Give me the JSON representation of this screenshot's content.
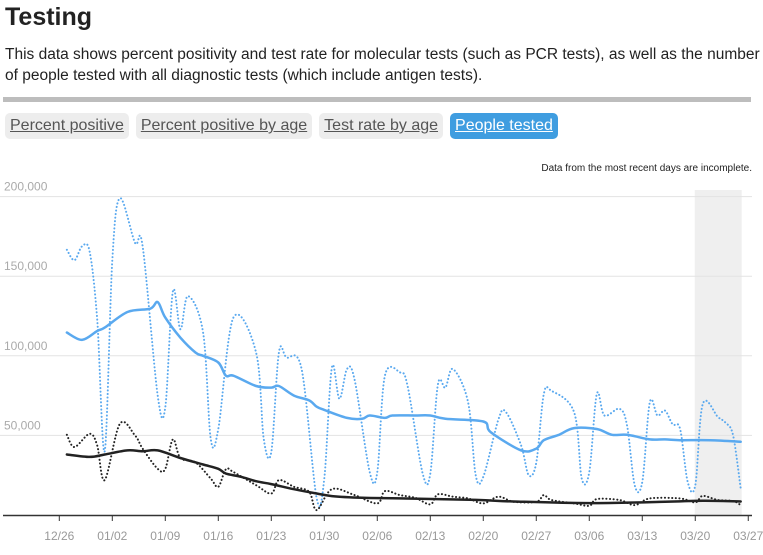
{
  "header": {
    "title": "Testing",
    "description": "This data shows percent positivity and test rate for molecular tests (such as PCR tests), as well as the number of people tested with all diagnostic tests (which include antigen tests)."
  },
  "tabs": [
    {
      "label": "Percent positive",
      "active": false
    },
    {
      "label": "Percent positive by age",
      "active": false
    },
    {
      "label": "Test rate by age",
      "active": false
    },
    {
      "label": "People tested",
      "active": true
    }
  ],
  "chart_note": "Data from the most recent days are incomplete.",
  "colors": {
    "blue": "#5aa9ef",
    "black": "#222222",
    "tab_active": "#3f9de0",
    "incomplete_shade": "#efefef",
    "grid": "#e3e3e3"
  },
  "chart_data": {
    "type": "line",
    "ylim": [
      0,
      200000
    ],
    "yticks": [
      "200,000",
      "150,000",
      "100,000",
      "50,000"
    ],
    "ytick_values": [
      200000,
      150000,
      100000,
      50000
    ],
    "xticks": [
      "12/26",
      "01/02",
      "01/09",
      "01/16",
      "01/23",
      "01/30",
      "02/06",
      "02/13",
      "02/20",
      "02/27",
      "03/06",
      "03/13",
      "03/20",
      "03/27"
    ],
    "xlim": [
      "12/26",
      "03/27"
    ],
    "grid": true,
    "incomplete_range": [
      "03/20",
      "03/26"
    ],
    "series": [
      {
        "color": "#5aa9ef",
        "style": "dotted",
        "points": [
          [
            "12/27",
            166600
          ],
          [
            "12/28",
            160000
          ],
          [
            "12/29",
            168700
          ],
          [
            "12/30",
            165600
          ],
          [
            "12/31",
            123000
          ],
          [
            "01/01",
            40000
          ],
          [
            "01/02",
            160000
          ],
          [
            "01/03",
            199000
          ],
          [
            "01/05",
            171000
          ],
          [
            "01/06",
            169000
          ],
          [
            "01/08",
            75000
          ],
          [
            "01/09",
            67700
          ],
          [
            "01/10",
            140600
          ],
          [
            "01/11",
            116700
          ],
          [
            "01/12",
            137500
          ],
          [
            "01/14",
            114600
          ],
          [
            "01/15",
            48000
          ],
          [
            "01/16",
            54000
          ],
          [
            "01/18",
            124000
          ],
          [
            "01/21",
            102000
          ],
          [
            "01/22",
            48000
          ],
          [
            "01/23",
            39600
          ],
          [
            "01/24",
            102000
          ],
          [
            "01/25",
            99000
          ],
          [
            "01/27",
            91700
          ],
          [
            "01/29",
            10400
          ],
          [
            "01/30",
            23000
          ],
          [
            "01/31",
            92700
          ],
          [
            "02/01",
            73000
          ],
          [
            "02/02",
            91700
          ],
          [
            "02/03",
            85000
          ],
          [
            "02/05",
            27000
          ],
          [
            "02/06",
            27000
          ],
          [
            "02/07",
            87500
          ],
          [
            "02/09",
            89600
          ],
          [
            "02/10",
            81000
          ],
          [
            "02/12",
            26000
          ],
          [
            "02/13",
            26000
          ],
          [
            "02/14",
            82000
          ],
          [
            "02/15",
            80000
          ],
          [
            "02/16",
            91700
          ],
          [
            "02/18",
            70800
          ],
          [
            "02/19",
            25000
          ],
          [
            "02/20",
            24000
          ],
          [
            "02/22",
            60000
          ],
          [
            "02/23",
            64600
          ],
          [
            "02/25",
            43700
          ],
          [
            "02/26",
            25000
          ],
          [
            "02/27",
            33000
          ],
          [
            "02/28",
            76000
          ],
          [
            "03/01",
            78000
          ],
          [
            "03/04",
            64600
          ],
          [
            "03/05",
            23000
          ],
          [
            "03/06",
            27000
          ],
          [
            "03/07",
            76000
          ],
          [
            "03/08",
            62500
          ],
          [
            "03/10",
            66700
          ],
          [
            "03/11",
            56000
          ],
          [
            "03/12",
            18700
          ],
          [
            "03/13",
            20800
          ],
          [
            "03/14",
            70800
          ],
          [
            "03/15",
            62500
          ],
          [
            "03/16",
            65600
          ],
          [
            "03/17",
            57000
          ],
          [
            "03/18",
            54000
          ],
          [
            "03/19",
            20800
          ],
          [
            "03/20",
            18700
          ],
          [
            "03/21",
            69800
          ],
          [
            "03/23",
            61500
          ],
          [
            "03/24",
            58000
          ],
          [
            "03/25",
            50000
          ],
          [
            "03/26",
            16700
          ]
        ]
      },
      {
        "color": "#5aa9ef",
        "style": "solid",
        "points": [
          [
            "12/27",
            114600
          ],
          [
            "12/29",
            110000
          ],
          [
            "12/31",
            115600
          ],
          [
            "01/01",
            117700
          ],
          [
            "01/04",
            127500
          ],
          [
            "01/07",
            129600
          ],
          [
            "01/08",
            133700
          ],
          [
            "01/09",
            124000
          ],
          [
            "01/11",
            111400
          ],
          [
            "01/13",
            102000
          ],
          [
            "01/14",
            100000
          ],
          [
            "01/16",
            95800
          ],
          [
            "01/17",
            87500
          ],
          [
            "01/18",
            87500
          ],
          [
            "01/21",
            81000
          ],
          [
            "01/23",
            80000
          ],
          [
            "01/24",
            81000
          ],
          [
            "01/26",
            75000
          ],
          [
            "01/28",
            72000
          ],
          [
            "01/29",
            68000
          ],
          [
            "01/30",
            66000
          ],
          [
            "02/02",
            61000
          ],
          [
            "02/04",
            60400
          ],
          [
            "02/05",
            62500
          ],
          [
            "02/07",
            61000
          ],
          [
            "02/08",
            62500
          ],
          [
            "02/11",
            62500
          ],
          [
            "02/13",
            62500
          ],
          [
            "02/15",
            60400
          ],
          [
            "02/20",
            58700
          ],
          [
            "02/21",
            52000
          ],
          [
            "02/25",
            40600
          ],
          [
            "02/27",
            41700
          ],
          [
            "02/28",
            47000
          ],
          [
            "03/02",
            50400
          ],
          [
            "03/04",
            54600
          ],
          [
            "03/07",
            54000
          ],
          [
            "03/09",
            50400
          ],
          [
            "03/11",
            50400
          ],
          [
            "03/14",
            47500
          ],
          [
            "03/16",
            47500
          ],
          [
            "03/18",
            47000
          ],
          [
            "03/22",
            47000
          ],
          [
            "03/26",
            46000
          ]
        ]
      },
      {
        "color": "#222222",
        "style": "dotted",
        "points": [
          [
            "12/27",
            50400
          ],
          [
            "12/28",
            42700
          ],
          [
            "12/30",
            51000
          ],
          [
            "12/31",
            43700
          ],
          [
            "01/01",
            21900
          ],
          [
            "01/03",
            57300
          ],
          [
            "01/05",
            50000
          ],
          [
            "01/06",
            41700
          ],
          [
            "01/08",
            29000
          ],
          [
            "01/09",
            29000
          ],
          [
            "01/10",
            47500
          ],
          [
            "01/11",
            35800
          ],
          [
            "01/13",
            33000
          ],
          [
            "01/15",
            22900
          ],
          [
            "01/16",
            17700
          ],
          [
            "01/17",
            28700
          ],
          [
            "01/18",
            27000
          ],
          [
            "01/21",
            18700
          ],
          [
            "01/23",
            13500
          ],
          [
            "01/24",
            21900
          ],
          [
            "01/26",
            17700
          ],
          [
            "01/28",
            14600
          ],
          [
            "01/29",
            3100
          ],
          [
            "01/31",
            16200
          ],
          [
            "02/03",
            12500
          ],
          [
            "02/06",
            7300
          ],
          [
            "02/07",
            15000
          ],
          [
            "02/09",
            12500
          ],
          [
            "02/11",
            10800
          ],
          [
            "02/13",
            6700
          ],
          [
            "02/14",
            13000
          ],
          [
            "02/16",
            11500
          ],
          [
            "02/18",
            10400
          ],
          [
            "02/20",
            7300
          ],
          [
            "02/22",
            11500
          ],
          [
            "02/24",
            8300
          ],
          [
            "02/27",
            8300
          ],
          [
            "02/28",
            12500
          ],
          [
            "03/01",
            9400
          ],
          [
            "03/04",
            7300
          ],
          [
            "03/06",
            5800
          ],
          [
            "03/07",
            10000
          ],
          [
            "03/10",
            9400
          ],
          [
            "03/12",
            6200
          ],
          [
            "03/14",
            10400
          ],
          [
            "03/18",
            10400
          ],
          [
            "03/20",
            7900
          ],
          [
            "03/21",
            12000
          ],
          [
            "03/23",
            9400
          ],
          [
            "03/25",
            8800
          ],
          [
            "03/26",
            6200
          ]
        ]
      },
      {
        "color": "#222222",
        "style": "solid",
        "points": [
          [
            "12/27",
            38000
          ],
          [
            "12/30",
            36500
          ],
          [
            "01/01",
            38000
          ],
          [
            "01/04",
            40600
          ],
          [
            "01/06",
            40000
          ],
          [
            "01/08",
            40600
          ],
          [
            "01/11",
            35800
          ],
          [
            "01/14",
            31700
          ],
          [
            "01/16",
            29000
          ],
          [
            "01/17",
            26000
          ],
          [
            "01/19",
            24000
          ],
          [
            "01/21",
            21200
          ],
          [
            "01/23",
            19400
          ],
          [
            "01/26",
            16200
          ],
          [
            "01/29",
            13500
          ],
          [
            "01/31",
            11900
          ],
          [
            "02/04",
            10800
          ],
          [
            "02/09",
            10400
          ],
          [
            "02/19",
            9500
          ],
          [
            "02/24",
            8500
          ],
          [
            "03/06",
            7500
          ],
          [
            "03/16",
            8300
          ],
          [
            "03/21",
            9000
          ],
          [
            "03/26",
            8500
          ]
        ]
      }
    ]
  }
}
